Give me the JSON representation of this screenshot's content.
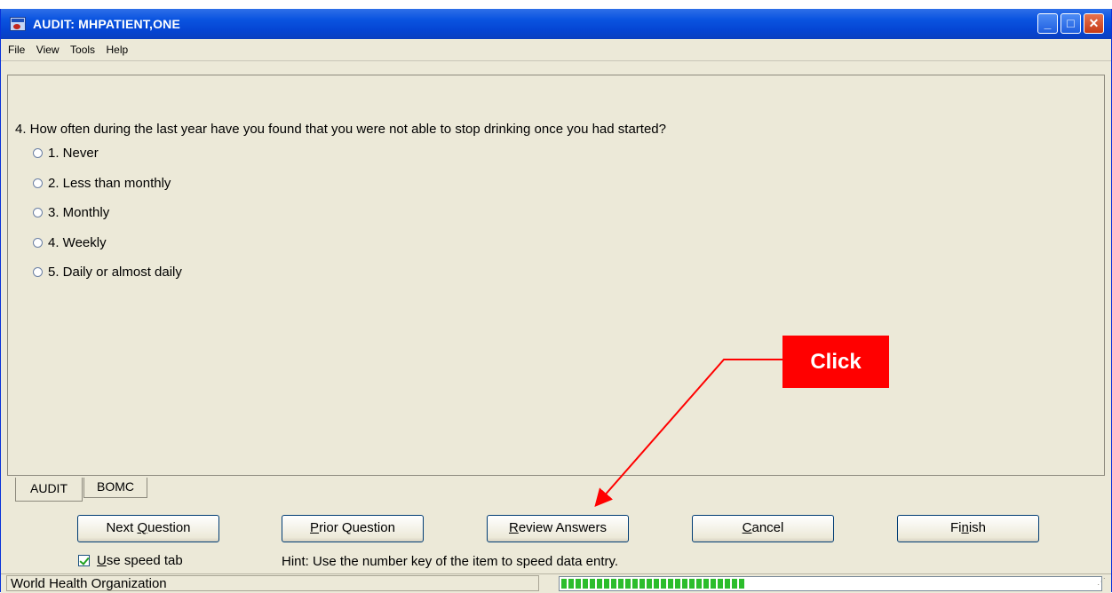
{
  "window": {
    "title": "AUDIT: MHPATIENT,ONE",
    "controls": [
      "minimize",
      "maximize",
      "close"
    ]
  },
  "menu": [
    "File",
    "View",
    "Tools",
    "Help"
  ],
  "question": {
    "text": "4. How often during the last year have you found that you were not able to stop drinking once you had started?",
    "options": [
      "1. Never",
      "2. Less than monthly",
      "3. Monthly",
      "4. Weekly",
      "5. Daily or almost daily"
    ]
  },
  "tabs": [
    "AUDIT",
    "BOMC"
  ],
  "buttons": {
    "next": {
      "pre": "Next ",
      "key": "Q",
      "post": "uestion"
    },
    "prior": {
      "pre": "",
      "key": "P",
      "post": "rior Question"
    },
    "review": {
      "pre": "",
      "key": "R",
      "post": "eview Answers"
    },
    "cancel": {
      "pre": "",
      "key": "C",
      "post": "ancel"
    },
    "finish": {
      "pre": "Fi",
      "key": "n",
      "post": "ish"
    }
  },
  "speed_tab": {
    "checked": true,
    "key": "U",
    "rest": "se speed tab"
  },
  "hint": "Hint: Use the number key of the item to speed data entry.",
  "status": {
    "text": "World Health Organization",
    "progress_fraction": 0.34
  },
  "annotation": {
    "label": "Click",
    "color": "#ff0000"
  }
}
